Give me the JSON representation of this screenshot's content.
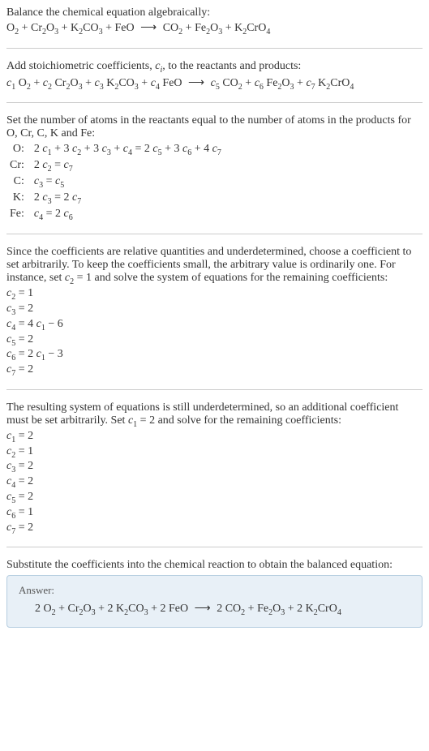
{
  "step1": {
    "intro": "Balance the chemical equation algebraically:",
    "eq_lhs_1": "O",
    "eq_lhs_1s": "2",
    "plus1": " + Cr",
    "eq_lhs_2s": "2",
    "eq_lhs_2b": "O",
    "eq_lhs_2bs": "3",
    "plus2": " + K",
    "eq_lhs_3s": "2",
    "eq_lhs_3b": "CO",
    "eq_lhs_3bs": "3",
    "plus3": " + FeO",
    "arrow": " ⟶ ",
    "rhs1": "CO",
    "rhs1s": "2",
    "plus4": " + Fe",
    "rhs2s": "2",
    "rhs2b": "O",
    "rhs2bs": "3",
    "plus5": " + K",
    "rhs3s": "2",
    "rhs3b": "CrO",
    "rhs3bs": "4"
  },
  "step2": {
    "intro_a": "Add stoichiometric coefficients, ",
    "ci": "c",
    "ci_sub": "i",
    "intro_b": ", to the reactants and products:",
    "c1": "c",
    "c1s": "1",
    "sp1": " O",
    "sp1s": "2",
    "p1": " + ",
    "c2": "c",
    "c2s": "2",
    "sp2": " Cr",
    "sp2s": "2",
    "sp2b": "O",
    "sp2bs": "3",
    "p2": " + ",
    "c3": "c",
    "c3s": "3",
    "sp3": " K",
    "sp3s": "2",
    "sp3b": "CO",
    "sp3bs": "3",
    "p3": " + ",
    "c4": "c",
    "c4s": "4",
    "sp4": " FeO",
    "arrow": " ⟶ ",
    "c5": "c",
    "c5s": "5",
    "sp5": " CO",
    "sp5s": "2",
    "p4": " + ",
    "c6": "c",
    "c6s": "6",
    "sp6": " Fe",
    "sp6s": "2",
    "sp6b": "O",
    "sp6bs": "3",
    "p5": " + ",
    "c7": "c",
    "c7s": "7",
    "sp7": " K",
    "sp7s": "2",
    "sp7b": "CrO",
    "sp7bs": "4"
  },
  "step3": {
    "intro": "Set the number of atoms in the reactants equal to the number of atoms in the products for O, Cr, C, K and Fe:",
    "rows": {
      "O_label": "O:",
      "O_eq_a": "2 ",
      "O_c1": "c",
      "O_c1s": "1",
      "O_p1": " + 3 ",
      "O_c2": "c",
      "O_c2s": "2",
      "O_p2": " + 3 ",
      "O_c3": "c",
      "O_c3s": "3",
      "O_p3": " + ",
      "O_c4": "c",
      "O_c4s": "4",
      "O_eq": " = 2 ",
      "O_c5": "c",
      "O_c5s": "5",
      "O_p4": " + 3 ",
      "O_c6": "c",
      "O_c6s": "6",
      "O_p5": " + 4 ",
      "O_c7": "c",
      "O_c7s": "7",
      "Cr_label": "Cr:",
      "Cr_a": "2 ",
      "Cr_c2": "c",
      "Cr_c2s": "2",
      "Cr_eq": " = ",
      "Cr_c7": "c",
      "Cr_c7s": "7",
      "C_label": "C:",
      "C_c3": "c",
      "C_c3s": "3",
      "C_eq": " = ",
      "C_c5": "c",
      "C_c5s": "5",
      "K_label": "K:",
      "K_a": "2 ",
      "K_c3": "c",
      "K_c3s": "3",
      "K_eq": " = 2 ",
      "K_c7": "c",
      "K_c7s": "7",
      "Fe_label": "Fe:",
      "Fe_c4": "c",
      "Fe_c4s": "4",
      "Fe_eq": " = 2 ",
      "Fe_c6": "c",
      "Fe_c6s": "6"
    }
  },
  "step4": {
    "intro_a": "Since the coefficients are relative quantities and underdetermined, choose a coefficient to set arbitrarily. To keep the coefficients small, the arbitrary value is ordinarily one. For instance, set ",
    "c2": "c",
    "c2s": "2",
    "intro_b": " = 1 and solve the system of equations for the remaining coefficients:",
    "lines": {
      "l1a": "c",
      "l1as": "2",
      "l1b": " = 1",
      "l2a": "c",
      "l2as": "3",
      "l2b": " = 2",
      "l3a": "c",
      "l3as": "4",
      "l3b": " = 4 ",
      "l3c": "c",
      "l3cs": "1",
      "l3d": " − 6",
      "l4a": "c",
      "l4as": "5",
      "l4b": " = 2",
      "l5a": "c",
      "l5as": "6",
      "l5b": " = 2 ",
      "l5c": "c",
      "l5cs": "1",
      "l5d": " − 3",
      "l6a": "c",
      "l6as": "7",
      "l6b": " = 2"
    }
  },
  "step5": {
    "intro_a": "The resulting system of equations is still underdetermined, so an additional coefficient must be set arbitrarily. Set ",
    "c1": "c",
    "c1s": "1",
    "intro_b": " = 2 and solve for the remaining coefficients:",
    "lines": {
      "l1a": "c",
      "l1as": "1",
      "l1b": " = 2",
      "l2a": "c",
      "l2as": "2",
      "l2b": " = 1",
      "l3a": "c",
      "l3as": "3",
      "l3b": " = 2",
      "l4a": "c",
      "l4as": "4",
      "l4b": " = 2",
      "l5a": "c",
      "l5as": "5",
      "l5b": " = 2",
      "l6a": "c",
      "l6as": "6",
      "l6b": " = 1",
      "l7a": "c",
      "l7as": "7",
      "l7b": " = 2"
    }
  },
  "step6": {
    "intro": "Substitute the coefficients into the chemical reaction to obtain the balanced equation:",
    "answer_label": "Answer:",
    "eq": {
      "t1": "2 O",
      "s1": "2",
      "p1": " + Cr",
      "s2": "2",
      "t2": "O",
      "s3": "3",
      "p2": " + 2 K",
      "s4": "2",
      "t3": "CO",
      "s5": "3",
      "p3": " + 2 FeO",
      "arrow": " ⟶ ",
      "t4": "2 CO",
      "s6": "2",
      "p4": " + Fe",
      "s7": "2",
      "t5": "O",
      "s8": "3",
      "p5": " + 2 K",
      "s9": "2",
      "t6": "CrO",
      "s10": "4"
    }
  }
}
